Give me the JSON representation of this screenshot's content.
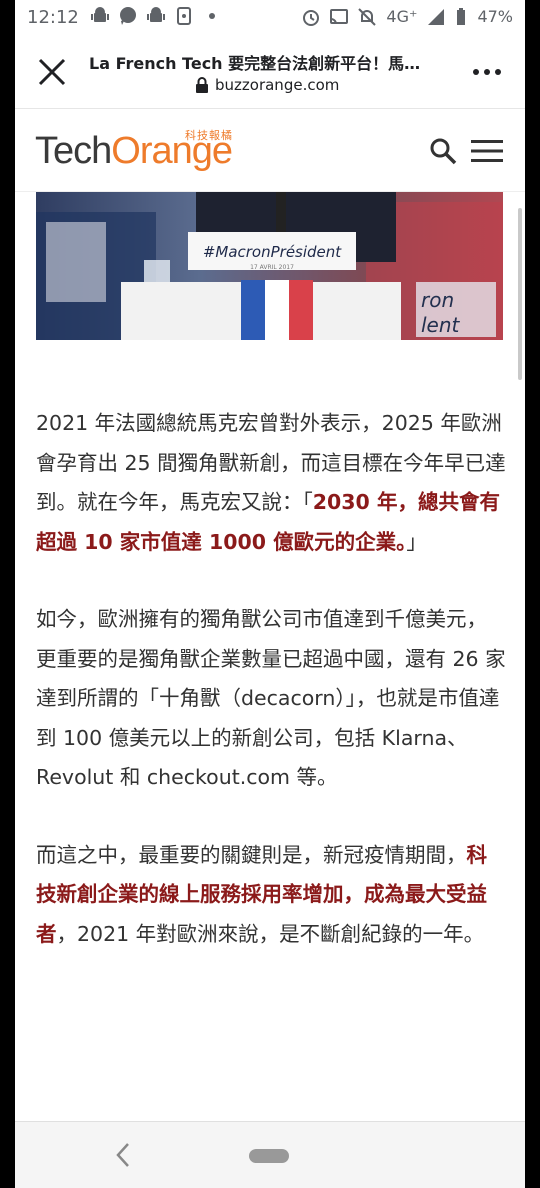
{
  "status_bar": {
    "time": "12:12",
    "left_icons": [
      "android-icon",
      "chat-bubble-icon",
      "android-icon",
      "sim-card-icon"
    ],
    "network": "4G⁺",
    "battery": "47%",
    "right_icons": [
      "alarm-icon",
      "cast-icon",
      "mute-icon",
      "signal-icon",
      "battery-icon"
    ]
  },
  "browser": {
    "title": "La French Tech 要完整台法創新平台！馬…",
    "url": "buzzorange.com"
  },
  "site": {
    "logo_tech": "Tech",
    "logo_orange": "Orange",
    "logo_sub": "科技報橘",
    "brand_color": "#ee7b2b"
  },
  "hero": {
    "sign_text": "#MacronPrésident",
    "sign_date": "17 AVRIL 2017",
    "poster_text_1": "ron",
    "poster_text_2": "lent"
  },
  "article": {
    "p1": {
      "pre": "2021 年法國總統馬克宏曾對外表示，2025 年歐洲會孕育出 25 間獨角獸新創，而這目標在今年早已達到。就在今年，馬克宏又說：「",
      "hl": "2030 年，總共會有超過 10 家市值達 1000 億歐元的企業。",
      "post": "」"
    },
    "p2": "如今，歐洲擁有的獨角獸公司市值達到千億美元，更重要的是獨角獸企業數量已超過中國，還有 26 家達到所謂的「十角獸（decacorn）」，也就是市值達到 100 億美元以上的新創公司，包括 Klarna、Revolut 和 checkout.com 等。",
    "p3": {
      "pre": "而這之中，最重要的關鍵則是，新冠疫情期間，",
      "hl": "科技新創企業的線上服務採用率增加，成為最大受益者",
      "post": "，2021 年對歐洲來說，是不斷創紀錄的一年。"
    },
    "highlight_color": "#8b1a1a"
  }
}
